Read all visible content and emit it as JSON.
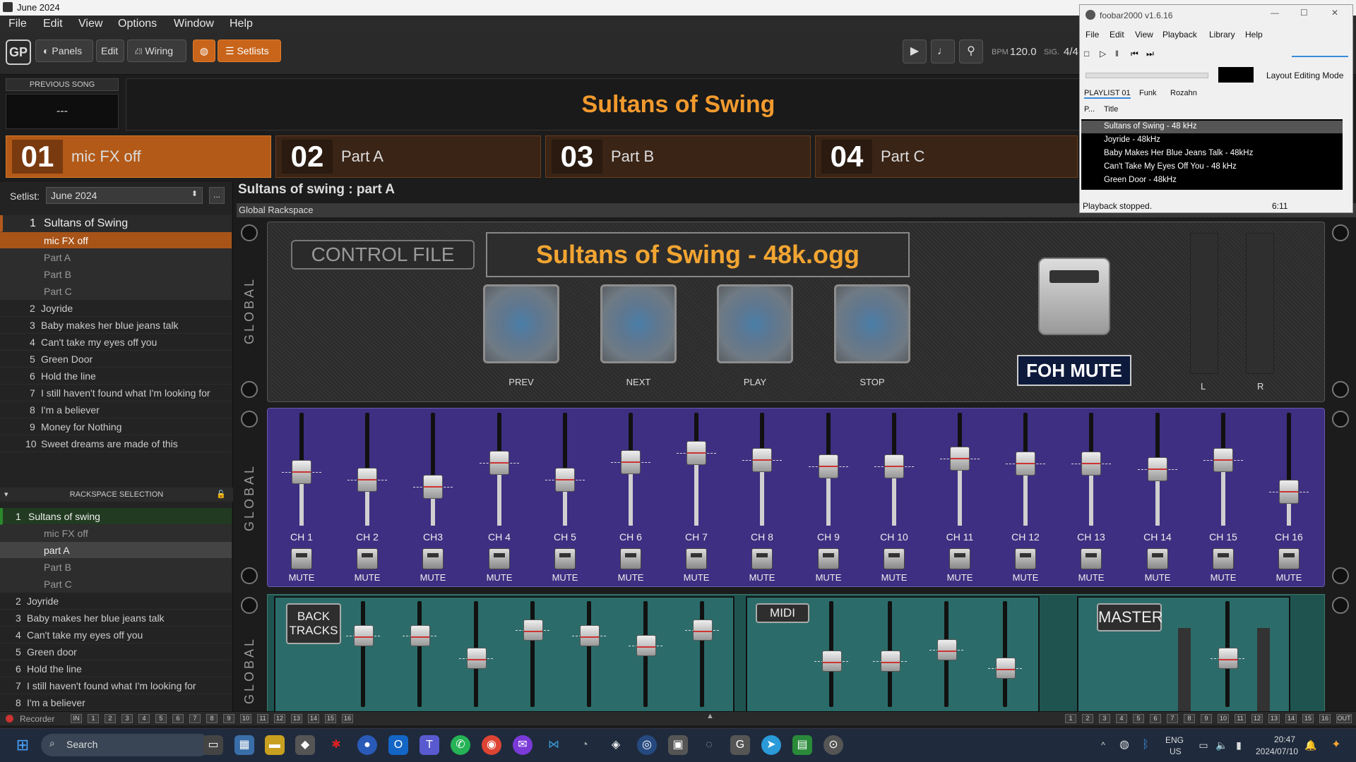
{
  "window": {
    "title": "June 2024"
  },
  "menu": [
    "File",
    "Edit",
    "View",
    "Options",
    "Window",
    "Help"
  ],
  "toolbar": {
    "panels": "Panels",
    "edit": "Edit",
    "wiring": "Wiring",
    "setlists": "Setlists",
    "bpm_label": "BPM",
    "bpm_value": "120.0",
    "sig_label": "SIG.",
    "sig_value": "4/4"
  },
  "header": {
    "previous_song_label": "PREVIOUS SONG",
    "previous_song_value": "---",
    "song_title": "Sultans of Swing"
  },
  "parts": [
    {
      "num": "01",
      "label": "mic FX off"
    },
    {
      "num": "02",
      "label": "Part A"
    },
    {
      "num": "03",
      "label": "Part B"
    },
    {
      "num": "04",
      "label": "Part C"
    }
  ],
  "setlist": {
    "label": "Setlist:",
    "selected": "June 2024",
    "more": "...",
    "songs": [
      {
        "n": "1",
        "title": "Sultans of Swing"
      },
      {
        "n": "",
        "title": "mic FX off"
      },
      {
        "n": "",
        "title": "Part A"
      },
      {
        "n": "",
        "title": "Part B"
      },
      {
        "n": "",
        "title": "Part C"
      },
      {
        "n": "2",
        "title": "Joyride"
      },
      {
        "n": "3",
        "title": "Baby makes her blue jeans talk"
      },
      {
        "n": "4",
        "title": "Can't take my eyes off you"
      },
      {
        "n": "5",
        "title": "Green Door"
      },
      {
        "n": "6",
        "title": "Hold the line"
      },
      {
        "n": "7",
        "title": "I still haven't found what I'm looking for"
      },
      {
        "n": "8",
        "title": "I'm a believer"
      },
      {
        "n": "9",
        "title": "Money for Nothing"
      },
      {
        "n": "10",
        "title": "Sweet dreams are made of this"
      }
    ]
  },
  "rackspace": {
    "label": "RACKSPACE SELECTION",
    "items": [
      {
        "n": "1",
        "title": "Sultans of swing"
      },
      {
        "n": "",
        "title": "mic FX off"
      },
      {
        "n": "",
        "title": "part A"
      },
      {
        "n": "",
        "title": "Part B"
      },
      {
        "n": "",
        "title": "Part C"
      },
      {
        "n": "2",
        "title": "Joyride"
      },
      {
        "n": "3",
        "title": "Baby makes her blue jeans talk"
      },
      {
        "n": "4",
        "title": "Can't take my eyes off you"
      },
      {
        "n": "5",
        "title": "Green door"
      },
      {
        "n": "6",
        "title": "Hold the line"
      },
      {
        "n": "7",
        "title": "I still haven't found what I'm looking for"
      },
      {
        "n": "8",
        "title": "I'm a believer"
      }
    ]
  },
  "main": {
    "path": "Sultans of swing : part A",
    "global_rackspace": "Global Rackspace",
    "side_label": "GLOBAL",
    "control_file": "CONTROL FILE",
    "file_name": "Sultans of Swing - 48k.ogg",
    "pads": [
      "PREV",
      "NEXT",
      "PLAY",
      "STOP"
    ],
    "foh_mute": "FOH MUTE",
    "meter_l": "L",
    "meter_r": "R"
  },
  "mixer": {
    "mute_label": "MUTE",
    "channels": [
      {
        "name": "CH 1",
        "level": 0.47
      },
      {
        "name": "CH 2",
        "level": 0.38
      },
      {
        "name": "CH3",
        "level": 0.3
      },
      {
        "name": "CH 4",
        "level": 0.57
      },
      {
        "name": "CH 5",
        "level": 0.38
      },
      {
        "name": "CH 6",
        "level": 0.58
      },
      {
        "name": "CH 7",
        "level": 0.68
      },
      {
        "name": "CH 8",
        "level": 0.6
      },
      {
        "name": "CH 9",
        "level": 0.53
      },
      {
        "name": "CH 10",
        "level": 0.53
      },
      {
        "name": "CH 11",
        "level": 0.62
      },
      {
        "name": "CH 12",
        "level": 0.56
      },
      {
        "name": "CH 13",
        "level": 0.56
      },
      {
        "name": "CH 14",
        "level": 0.5
      },
      {
        "name": "CH 15",
        "level": 0.6
      },
      {
        "name": "CH 16",
        "level": 0.25
      }
    ]
  },
  "bottom": {
    "back_tracks": "BACK\nTRACKS",
    "midi": "MIDI",
    "master": "MASTER",
    "back_levels": [
      0.72,
      0.72,
      0.45,
      0.78,
      0.72,
      0.6,
      0.78
    ],
    "midi_levels": [
      0.42,
      0.42,
      0.55,
      0.33
    ],
    "master_level": 0.45
  },
  "recorder": {
    "label": "Recorder",
    "in": "IN",
    "out": "OUT"
  },
  "taskbar": {
    "search": "Search",
    "lang": "ENG",
    "region": "US",
    "time": "20:47",
    "date": "2024/07/10"
  },
  "foobar": {
    "title": "foobar2000 v1.6.16",
    "menu": [
      "File",
      "Edit",
      "View",
      "Playback",
      "Library",
      "Help"
    ],
    "layout_mode": "Layout Editing Mode",
    "tabs": [
      "PLAYLIST 01",
      "Funk",
      "Rozahn"
    ],
    "col_p": "P...",
    "col_title": "Title",
    "tracks": [
      "Sultans of Swing - 48 kHz",
      "Joyride - 48kHz",
      "Baby Makes Her Blue Jeans Talk - 48kHz",
      "Can't Take My Eyes Off You - 48 kHz",
      "Green Door - 48kHz"
    ],
    "status": "Playback stopped.",
    "time": "6:11"
  }
}
